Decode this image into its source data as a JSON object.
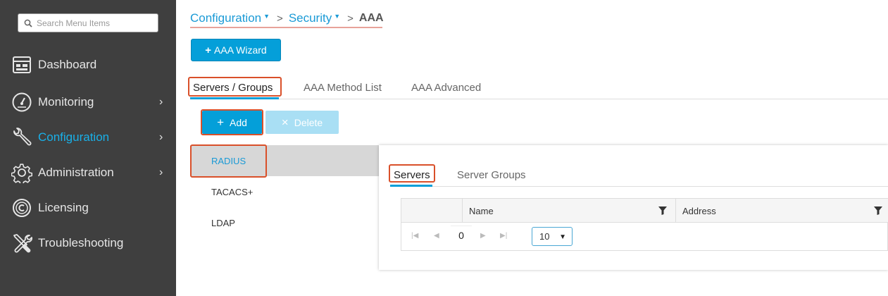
{
  "sidebar": {
    "search_placeholder": "Search Menu Items",
    "items": [
      {
        "label": "Dashboard",
        "icon": "dashboard-icon",
        "has_submenu": false
      },
      {
        "label": "Monitoring",
        "icon": "gauge-icon",
        "has_submenu": true
      },
      {
        "label": "Configuration",
        "icon": "wrench-icon",
        "has_submenu": true,
        "active": true
      },
      {
        "label": "Administration",
        "icon": "gear-icon",
        "has_submenu": true
      },
      {
        "label": "Licensing",
        "icon": "licensing-icon",
        "has_submenu": false
      },
      {
        "label": "Troubleshooting",
        "icon": "tools-icon",
        "has_submenu": false
      }
    ],
    "chevron": "›"
  },
  "breadcrumb": {
    "items": [
      "Configuration",
      "Security"
    ],
    "current": "AAA",
    "separator": ">"
  },
  "wizard_button": {
    "label": "AAA Wizard"
  },
  "top_tabs": [
    {
      "label": "Servers / Groups",
      "active": true
    },
    {
      "label": "AAA Method List",
      "active": false
    },
    {
      "label": "AAA Advanced",
      "active": false
    }
  ],
  "actions": {
    "add_label": "Add",
    "delete_label": "Delete"
  },
  "server_types": [
    {
      "label": "RADIUS",
      "selected": true
    },
    {
      "label": "TACACS+",
      "selected": false
    },
    {
      "label": "LDAP",
      "selected": false
    }
  ],
  "panel": {
    "tabs": [
      {
        "label": "Servers",
        "active": true
      },
      {
        "label": "Server Groups",
        "active": false
      }
    ],
    "grid": {
      "columns": [
        "Name",
        "Address"
      ],
      "page_number": "0",
      "page_size": "10"
    }
  },
  "colors": {
    "sidebar_bg": "#3f3f3f",
    "accent": "#049fd9",
    "highlight": "#d9502a",
    "active_nav": "#19b0e8"
  }
}
